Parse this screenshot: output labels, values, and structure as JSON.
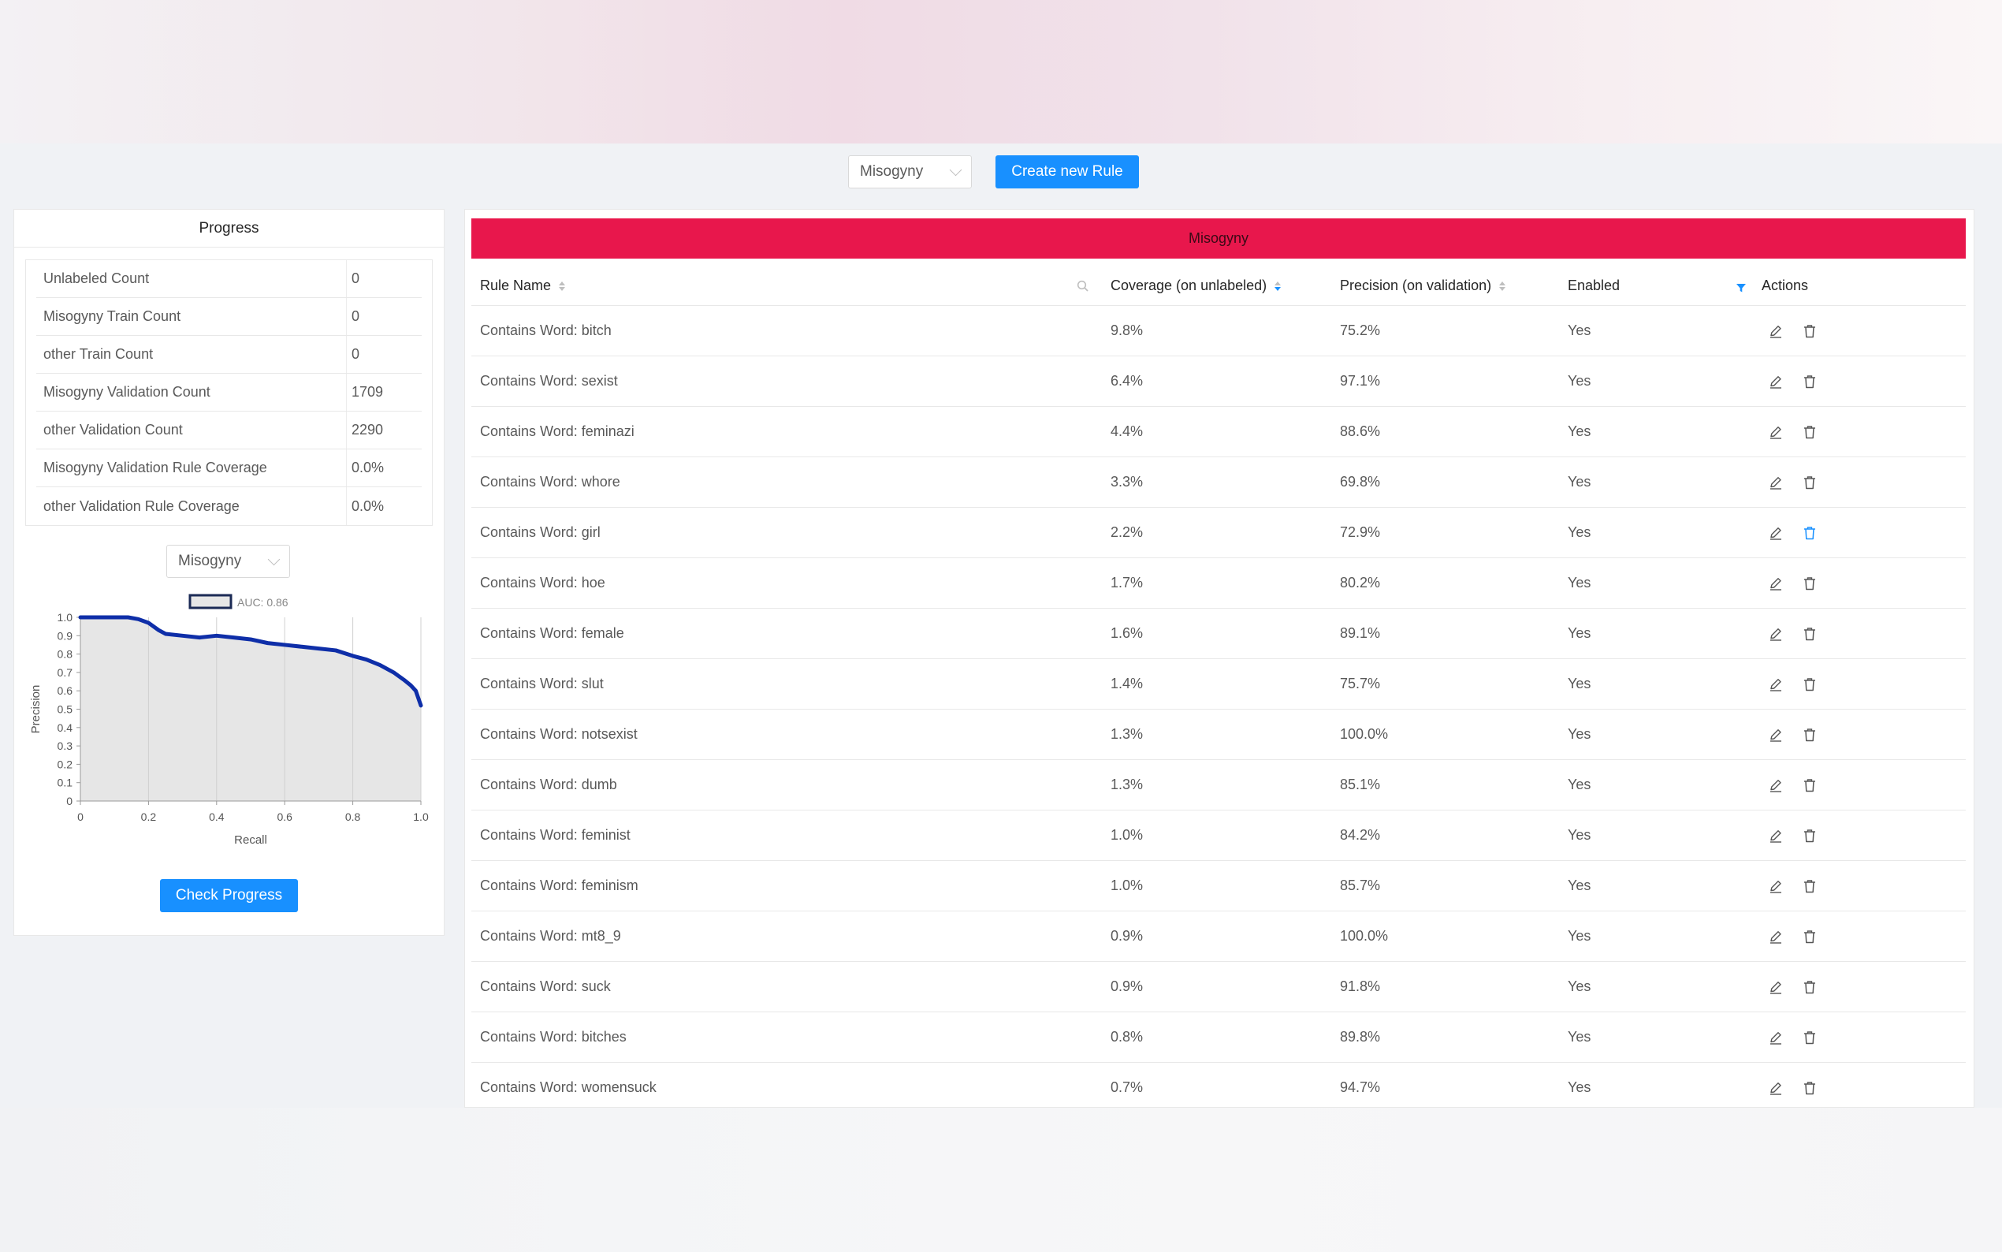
{
  "toolbar": {
    "label_select": "Misogyny",
    "create_button": "Create new Rule"
  },
  "progress": {
    "title": "Progress",
    "stats": [
      {
        "label": "Unlabeled Count",
        "value": "0"
      },
      {
        "label": "Misogyny Train Count",
        "value": "0"
      },
      {
        "label": "other Train Count",
        "value": "0"
      },
      {
        "label": "Misogyny Validation Count",
        "value": "1709"
      },
      {
        "label": "other Validation Count",
        "value": "2290"
      },
      {
        "label": "Misogyny Validation Rule Coverage",
        "value": "0.0%"
      },
      {
        "label": "other Validation Rule Coverage",
        "value": "0.0%"
      }
    ],
    "chart_select": "Misogyny",
    "check_button": "Check Progress"
  },
  "chart_data": {
    "type": "area",
    "legend": "AUC: 0.86",
    "xlabel": "Recall",
    "ylabel": "Precision",
    "xlim": [
      0,
      1.0
    ],
    "ylim": [
      0,
      1.0
    ],
    "x_ticks": [
      "0",
      "0.2",
      "0.4",
      "0.6",
      "0.8",
      "1.0"
    ],
    "y_ticks": [
      "0",
      "0.1",
      "0.2",
      "0.3",
      "0.4",
      "0.5",
      "0.6",
      "0.7",
      "0.8",
      "0.9",
      "1.0"
    ],
    "grid": true,
    "line_color": "#0e2ea8",
    "fill_color": "#e6e6e6",
    "x": [
      0.0,
      0.05,
      0.1,
      0.14,
      0.17,
      0.2,
      0.23,
      0.25,
      0.3,
      0.35,
      0.4,
      0.45,
      0.5,
      0.55,
      0.6,
      0.65,
      0.7,
      0.75,
      0.8,
      0.84,
      0.88,
      0.92,
      0.95,
      0.97,
      0.985,
      1.0
    ],
    "y": [
      1.0,
      1.0,
      1.0,
      1.0,
      0.99,
      0.97,
      0.93,
      0.91,
      0.9,
      0.89,
      0.9,
      0.89,
      0.88,
      0.86,
      0.85,
      0.84,
      0.83,
      0.82,
      0.79,
      0.77,
      0.74,
      0.7,
      0.66,
      0.63,
      0.6,
      0.52
    ]
  },
  "rules": {
    "header_label": "Misogyny",
    "columns": {
      "name": "Rule Name",
      "coverage": "Coverage (on unlabeled)",
      "precision": "Precision (on validation)",
      "enabled": "Enabled",
      "actions": "Actions"
    },
    "rows": [
      {
        "name": "Contains Word: bitch",
        "coverage": "9.8%",
        "precision": "75.2%",
        "enabled": "Yes"
      },
      {
        "name": "Contains Word: sexist",
        "coverage": "6.4%",
        "precision": "97.1%",
        "enabled": "Yes"
      },
      {
        "name": "Contains Word: feminazi",
        "coverage": "4.4%",
        "precision": "88.6%",
        "enabled": "Yes"
      },
      {
        "name": "Contains Word: whore",
        "coverage": "3.3%",
        "precision": "69.8%",
        "enabled": "Yes"
      },
      {
        "name": "Contains Word: girl",
        "coverage": "2.2%",
        "precision": "72.9%",
        "enabled": "Yes",
        "delete_hover": true
      },
      {
        "name": "Contains Word: hoe",
        "coverage": "1.7%",
        "precision": "80.2%",
        "enabled": "Yes"
      },
      {
        "name": "Contains Word: female",
        "coverage": "1.6%",
        "precision": "89.1%",
        "enabled": "Yes"
      },
      {
        "name": "Contains Word: slut",
        "coverage": "1.4%",
        "precision": "75.7%",
        "enabled": "Yes"
      },
      {
        "name": "Contains Word: notsexist",
        "coverage": "1.3%",
        "precision": "100.0%",
        "enabled": "Yes"
      },
      {
        "name": "Contains Word: dumb",
        "coverage": "1.3%",
        "precision": "85.1%",
        "enabled": "Yes"
      },
      {
        "name": "Contains Word: feminist",
        "coverage": "1.0%",
        "precision": "84.2%",
        "enabled": "Yes"
      },
      {
        "name": "Contains Word: feminism",
        "coverage": "1.0%",
        "precision": "85.7%",
        "enabled": "Yes"
      },
      {
        "name": "Contains Word: mt8_9",
        "coverage": "0.9%",
        "precision": "100.0%",
        "enabled": "Yes"
      },
      {
        "name": "Contains Word: suck",
        "coverage": "0.9%",
        "precision": "91.8%",
        "enabled": "Yes"
      },
      {
        "name": "Contains Word: bitches",
        "coverage": "0.8%",
        "precision": "89.8%",
        "enabled": "Yes"
      },
      {
        "name": "Contains Word: womensuck",
        "coverage": "0.7%",
        "precision": "94.7%",
        "enabled": "Yes"
      }
    ]
  },
  "colors": {
    "accent": "#1890ff",
    "rule_header": "#e8174c"
  },
  "icons": {
    "edit": "edit-icon",
    "delete": "delete-icon",
    "search": "search-icon",
    "filter": "filter-icon",
    "sort": "sort-icon",
    "dropdown": "chevron-down-icon"
  }
}
